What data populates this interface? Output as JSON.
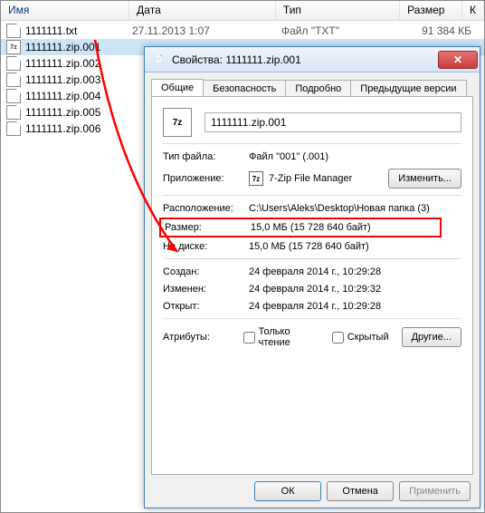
{
  "columns": {
    "name": "Имя",
    "date": "Дата",
    "type": "Тип",
    "size": "Размер",
    "x": "К"
  },
  "files": [
    {
      "name": "1111111.txt",
      "date": "27.11.2013 1:07",
      "type": "Файл \"TXT\"",
      "size": "91 384 КБ",
      "icon": "txt",
      "sel": false
    },
    {
      "name": "1111111.zip.001",
      "date": "",
      "type": "",
      "size": "",
      "icon": "zp",
      "sel": true
    },
    {
      "name": "1111111.zip.002",
      "date": "",
      "type": "",
      "size": "",
      "icon": "txt",
      "sel": false
    },
    {
      "name": "1111111.zip.003",
      "date": "",
      "type": "",
      "size": "",
      "icon": "txt",
      "sel": false
    },
    {
      "name": "1111111.zip.004",
      "date": "",
      "type": "",
      "size": "",
      "icon": "txt",
      "sel": false
    },
    {
      "name": "1111111.zip.005",
      "date": "",
      "type": "",
      "size": "",
      "icon": "txt",
      "sel": false
    },
    {
      "name": "1111111.zip.006",
      "date": "",
      "type": "",
      "size": "",
      "icon": "txt",
      "sel": false
    }
  ],
  "dlg": {
    "title": "Свойства: 1111111.zip.001",
    "tabs": {
      "t1": "Общие",
      "t2": "Безопасность",
      "t3": "Подробно",
      "t4": "Предыдущие версии"
    },
    "icon": "7z",
    "name": "1111111.zip.001",
    "rows": {
      "fileType_lbl": "Тип файла:",
      "fileType_val": "Файл \"001\" (.001)",
      "app_lbl": "Приложение:",
      "app_val": "7-Zip File Manager",
      "app_btn": "Изменить...",
      "loc_lbl": "Расположение:",
      "loc_val": "C:\\Users\\Aleks\\Desktop\\Новая папка (3)",
      "size_lbl": "Размер:",
      "size_val": "15,0 МБ (15 728 640 байт)",
      "disk_lbl": "На диске:",
      "disk_val": "15,0 МБ (15 728 640 байт)",
      "cr_lbl": "Создан:",
      "cr_val": "24 февраля 2014 г., 10:29:28",
      "mod_lbl": "Изменен:",
      "mod_val": "24 февраля 2014 г., 10:29:32",
      "acc_lbl": "Открыт:",
      "acc_val": "24 февраля 2014 г., 10:29:28",
      "attr_lbl": "Атрибуты:",
      "attr_ro": "Только чтение",
      "attr_hidden": "Скрытый",
      "attr_btn": "Другие..."
    },
    "btns": {
      "ok": "ОК",
      "cancel": "Отмена",
      "apply": "Применить"
    }
  }
}
